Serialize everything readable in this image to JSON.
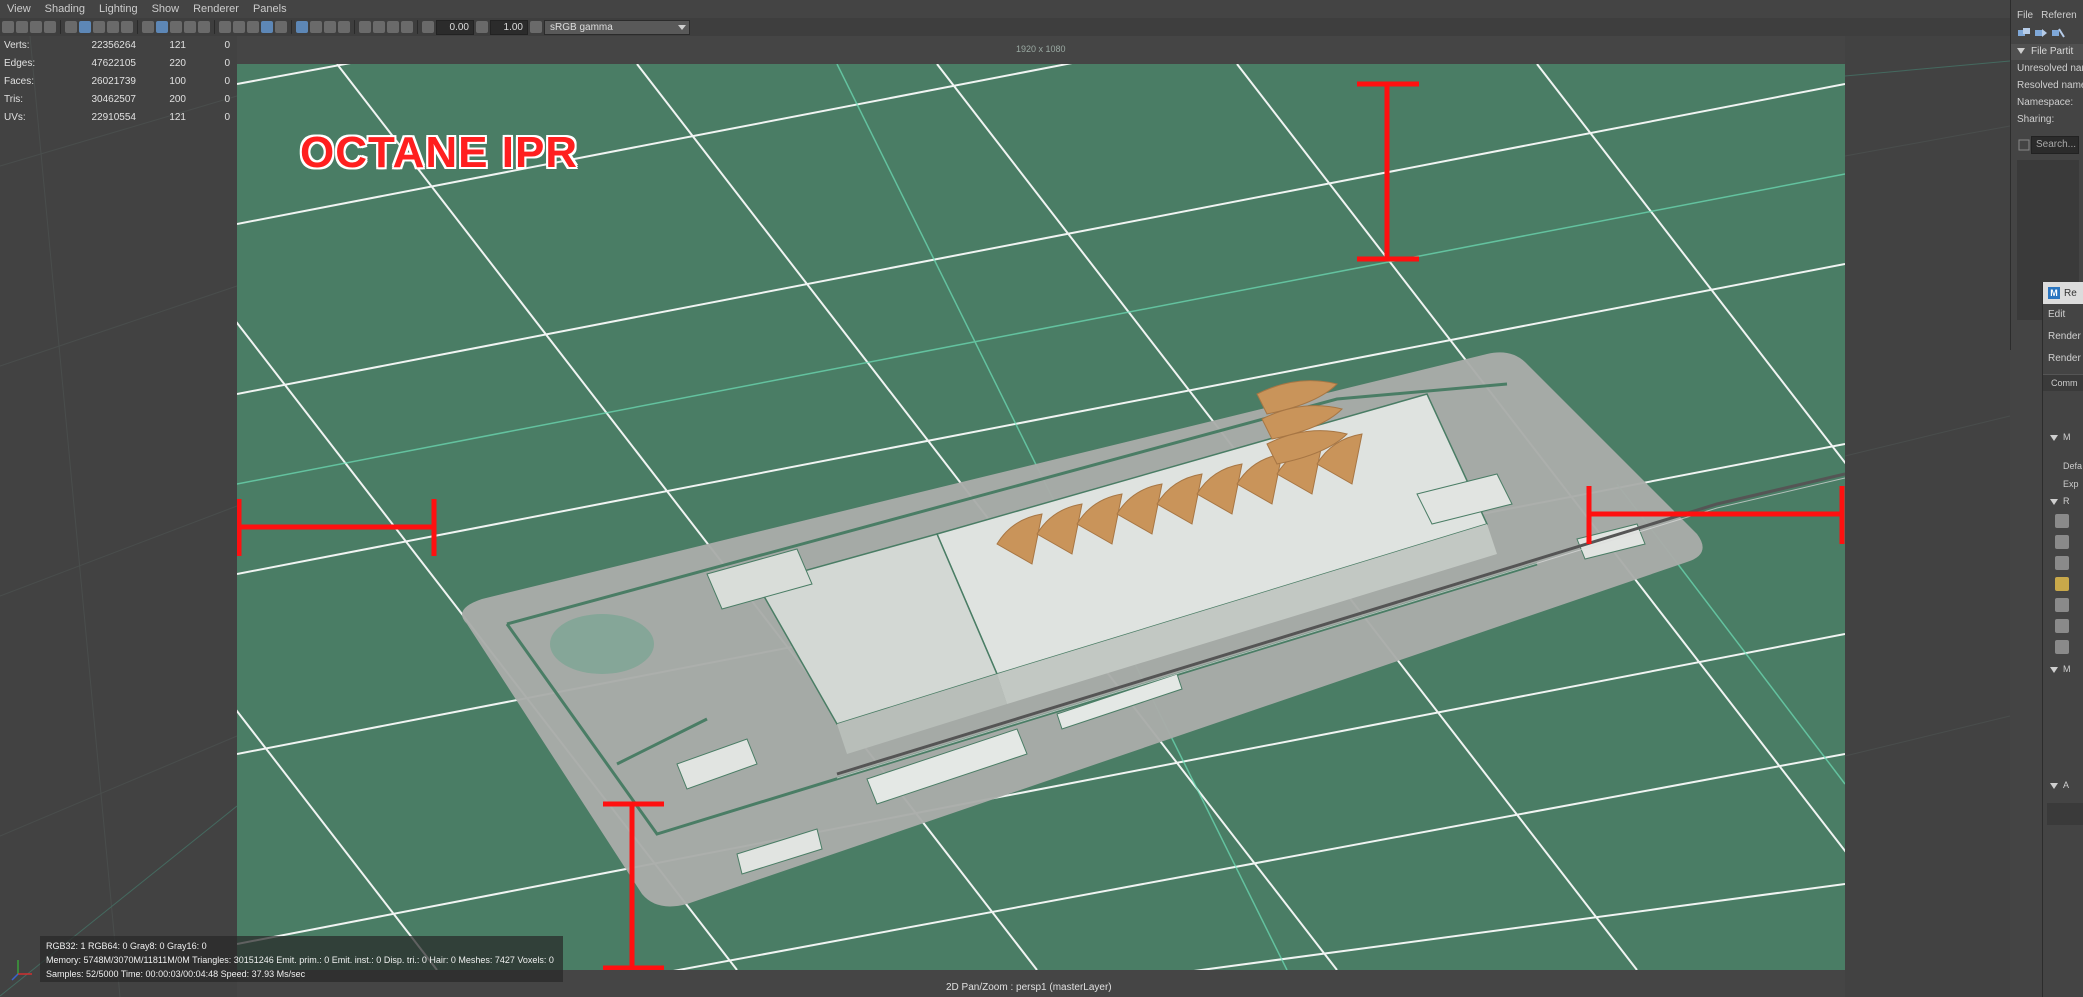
{
  "menubar": {
    "items": [
      "View",
      "Shading",
      "Lighting",
      "Show",
      "Renderer",
      "Panels"
    ]
  },
  "toolbar": {
    "exposure_value": "0.00",
    "gamma_value": "1.00",
    "color_space": "sRGB gamma"
  },
  "hud": {
    "rows": [
      {
        "label": "Verts:",
        "v1": "22356264",
        "v2": "121",
        "v3": "0"
      },
      {
        "label": "Edges:",
        "v1": "47622105",
        "v2": "220",
        "v3": "0"
      },
      {
        "label": "Faces:",
        "v1": "26021739",
        "v2": "100",
        "v3": "0"
      },
      {
        "label": "Tris:",
        "v1": "30462507",
        "v2": "200",
        "v3": "0"
      },
      {
        "label": "UVs:",
        "v1": "22910554",
        "v2": "121",
        "v3": "0"
      }
    ]
  },
  "viewport": {
    "resolution": "1920 x 1080",
    "annotation": "OCTANE IPR",
    "camera_label": "2D Pan/Zoom : persp1 (masterLayer)",
    "render_stats": {
      "line1": "RGB32: 1 RGB64: 0 Gray8: 0 Gray16: 0",
      "line2": "Memory: 5748M/3070M/11811M/0M Triangles: 30151246 Emit. prim.: 0 Emit. inst.: 0 Disp. tri.: 0 Hair: 0 Meshes: 7427 Voxels: 0",
      "line3": "Samples: 52/5000 Time: 00:00:03/00:04:48 Speed: 37.93 Ms/sec"
    },
    "annotation_color": "#ff1f1f",
    "ground_color": "#4a7d65",
    "terrain_color": "#a9aca9",
    "roof_accent_color": "#c9945a"
  },
  "attribute_panel": {
    "menu": [
      "File",
      "Referen"
    ],
    "section": "File Partit",
    "fields": [
      "Unresolved nam",
      "Resolved name:",
      "Namespace:",
      "Sharing:"
    ],
    "search_placeholder": "Search..."
  },
  "render_settings": {
    "title": "Re",
    "menu": [
      "Edit",
      "Render",
      "Render"
    ],
    "tab": "Comm",
    "sections": [
      "M",
      "R",
      "M",
      "A"
    ],
    "texts": [
      "Defa",
      "Exp"
    ]
  }
}
